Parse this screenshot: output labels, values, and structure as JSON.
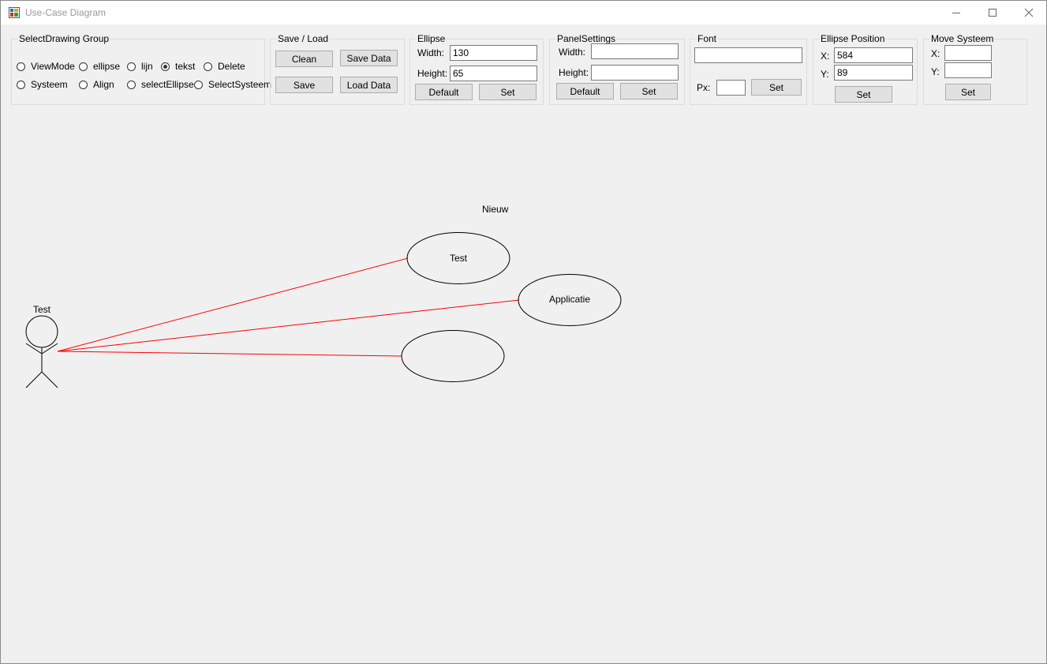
{
  "window": {
    "title": "Use-Case Diagram"
  },
  "groups": {
    "select_drawing": {
      "title": "SelectDrawing Group",
      "radios": [
        {
          "label": "ViewMode",
          "checked": false
        },
        {
          "label": "ellipse",
          "checked": false
        },
        {
          "label": "lijn",
          "checked": false
        },
        {
          "label": "tekst",
          "checked": true
        },
        {
          "label": "Delete",
          "checked": false
        },
        {
          "label": "Systeem",
          "checked": false
        },
        {
          "label": "Align",
          "checked": false
        },
        {
          "label": "selectEllipse",
          "checked": false
        },
        {
          "label": "SelectSysteem",
          "checked": false
        }
      ]
    },
    "save_load": {
      "title": "Save / Load",
      "clean": "Clean",
      "save_data": "Save Data",
      "save": "Save",
      "load_data": "Load Data"
    },
    "ellipse": {
      "title": "Ellipse",
      "width_label": "Width:",
      "width_value": "130",
      "height_label": "Height:",
      "height_value": "65",
      "default_btn": "Default",
      "set_btn": "Set"
    },
    "panel_settings": {
      "title": "PanelSettings",
      "width_label": "Width:",
      "width_value": "",
      "height_label": "Height:",
      "height_value": "",
      "default_btn": "Default",
      "set_btn": "Set"
    },
    "font": {
      "title": "Font",
      "font_value": "",
      "px_label": "Px:",
      "px_value": "",
      "set_btn": "Set"
    },
    "ellipse_position": {
      "title": "Ellipse Position",
      "x_label": "X:",
      "x_value": "584",
      "y_label": "Y:",
      "y_value": "89",
      "set_btn": "Set"
    },
    "move_systeem": {
      "title": "Move Systeem",
      "x_label": "X:",
      "x_value": "",
      "y_label": "Y:",
      "y_value": "",
      "set_btn": "Set"
    }
  },
  "diagram": {
    "free_text": "Nieuw",
    "actor_label": "Test",
    "use_cases": [
      "Test",
      "Applicatie",
      ""
    ],
    "line_color": "#ff0000"
  }
}
